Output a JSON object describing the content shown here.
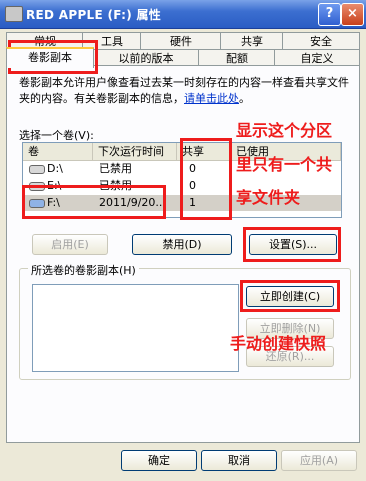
{
  "window": {
    "title": "RED APPLE (F:) 属性",
    "help_glyph": "?",
    "close_glyph": "×"
  },
  "tabs_row1": [
    "常规",
    "工具",
    "硬件",
    "共享",
    "安全"
  ],
  "tabs_row2": [
    "卷影副本",
    "以前的版本",
    "配额",
    "自定义"
  ],
  "description": {
    "text": "卷影副本允许用户像查看过去某一时刻存在的内容一样查看共享文件夹的内容。有关卷影副本的信息，",
    "link": "请单击此处",
    "suffix": "。"
  },
  "select_volume_label": "选择一个卷(V):",
  "volume_table": {
    "columns": [
      "卷",
      "下次运行时间",
      "共享",
      "已使用"
    ],
    "rows": [
      {
        "volume": "D:\\",
        "next_run": "已禁用",
        "shares": "0",
        "used": ""
      },
      {
        "volume": "E:\\",
        "next_run": "已禁用",
        "shares": "0",
        "used": ""
      },
      {
        "volume": "F:\\",
        "next_run": "2011/9/20...",
        "shares": "1",
        "used": ""
      }
    ]
  },
  "buttons": {
    "enable": "启用(E)",
    "disable": "禁用(D)",
    "settings": "设置(S)...",
    "create_now": "立即创建(C)",
    "delete_now": "立即删除(N)",
    "revert": "还原(R)...",
    "ok": "确定",
    "cancel": "取消",
    "apply": "应用(A)"
  },
  "shadow_copies_group_label": "所选卷的卷影副本(H)",
  "annotations": {
    "share_note_line1": "显示这个分区",
    "share_note_line2": "里只有一个共",
    "share_note_line3": "享文件夹",
    "snapshot_note": "手动创建快照"
  },
  "colors": {
    "titlebar": "#2a5cc4",
    "annotation_red": "#ee1c1c",
    "tab_highlight": "#ffc83c"
  }
}
